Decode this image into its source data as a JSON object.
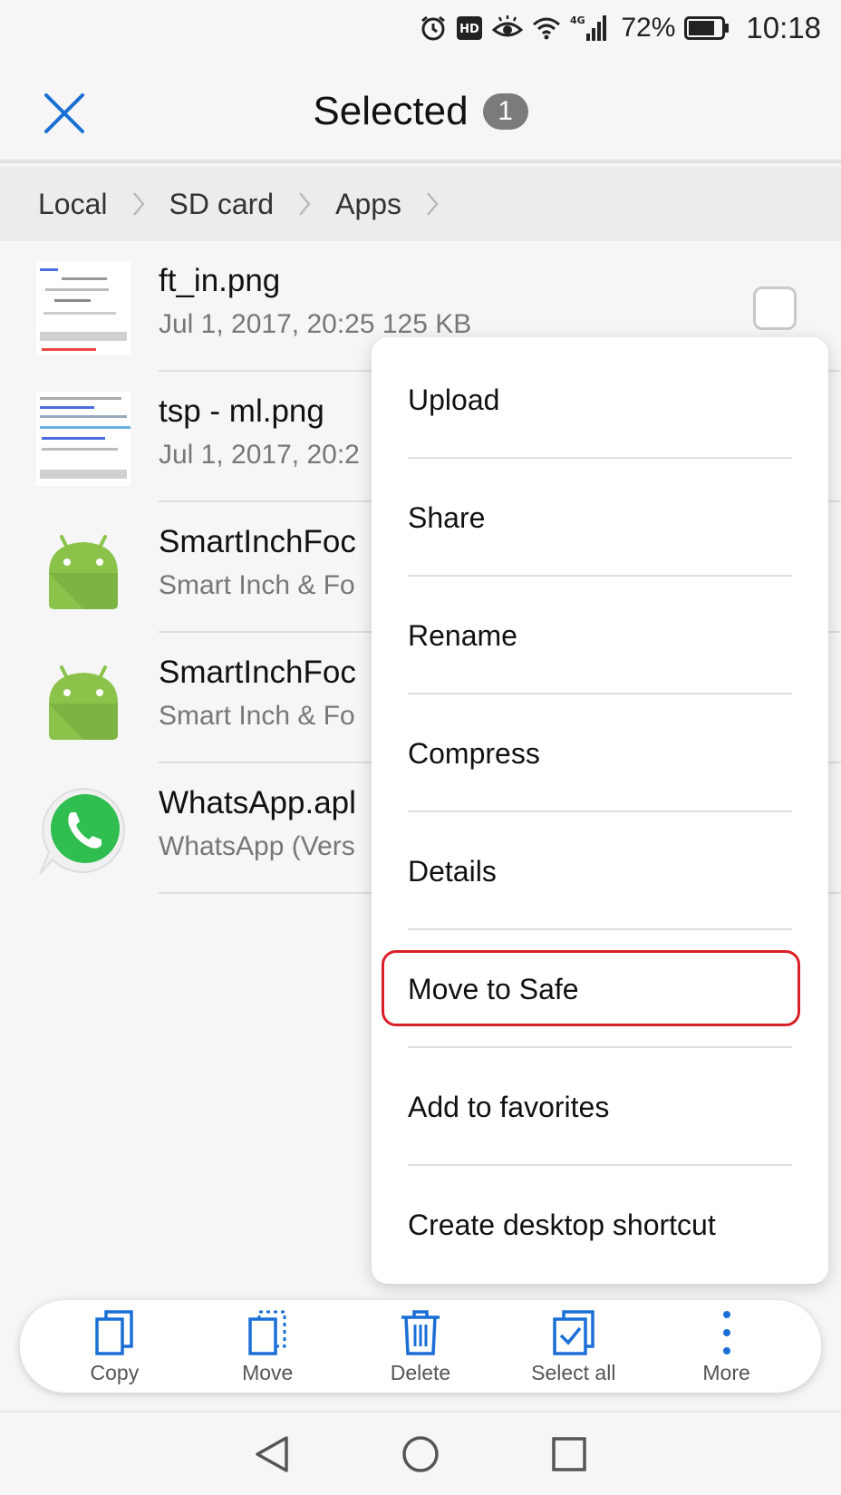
{
  "status_bar": {
    "battery_percent": "72%",
    "time": "10:18",
    "icons": [
      "alarm-icon",
      "hd-icon",
      "eye-comfort-icon",
      "wifi-icon",
      "signal-4g-icon",
      "battery-icon"
    ]
  },
  "header": {
    "title": "Selected",
    "count": "1"
  },
  "breadcrumb": [
    "Local",
    "SD card",
    "Apps"
  ],
  "files": [
    {
      "name": "ft_in.png",
      "meta": "Jul 1, 2017, 20:25 125 KB",
      "thumb": "image-thumb"
    },
    {
      "name": "tsp - ml.png",
      "meta": "Jul 1, 2017, 20:2",
      "thumb": "image-thumb"
    },
    {
      "name": "SmartInchFoc",
      "meta": "Smart Inch & Fo",
      "thumb": "android-icon"
    },
    {
      "name": "SmartInchFoc",
      "meta": "Smart Inch & Fo",
      "thumb": "android-icon"
    },
    {
      "name": "WhatsApp.apl",
      "meta": "WhatsApp (Vers",
      "thumb": "whatsapp-icon"
    }
  ],
  "menu": {
    "items": [
      "Upload",
      "Share",
      "Rename",
      "Compress",
      "Details",
      "Move to Safe",
      "Add to favorites",
      "Create desktop shortcut"
    ],
    "highlighted": "Move to Safe",
    "highlight_color": "#d9202a"
  },
  "actions": [
    {
      "label": "Copy",
      "icon": "copy-icon"
    },
    {
      "label": "Move",
      "icon": "move-icon"
    },
    {
      "label": "Delete",
      "icon": "trash-icon"
    },
    {
      "label": "Select all",
      "icon": "select-all-icon"
    },
    {
      "label": "More",
      "icon": "more-vertical-icon"
    }
  ],
  "colors": {
    "accent": "#1a6fd6",
    "android_green": "#8bc34a",
    "whatsapp_green": "#2fbe4f"
  }
}
